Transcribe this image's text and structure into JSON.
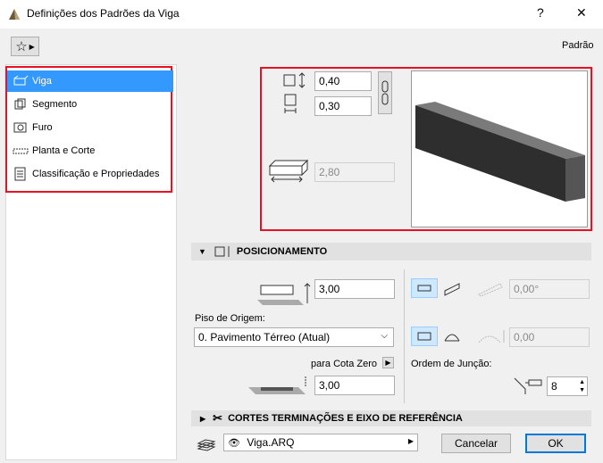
{
  "window": {
    "title": "Definições dos Padrões da Viga",
    "help": "?",
    "close": "✕"
  },
  "header": {
    "favorites_icon": "star-icon",
    "preset_label": "Padrão"
  },
  "sidebar": {
    "items": [
      {
        "label": "Viga",
        "icon": "beam-icon",
        "selected": true
      },
      {
        "label": "Segmento",
        "icon": "segment-icon"
      },
      {
        "label": "Furo",
        "icon": "hole-icon"
      },
      {
        "label": "Planta e Corte",
        "icon": "plan-section-icon"
      },
      {
        "label": "Classificação e Propriedades",
        "icon": "classification-icon"
      }
    ]
  },
  "geometry": {
    "height": "0,40",
    "width": "0,30",
    "length": "2,80"
  },
  "positioning": {
    "section_title": "POSICIONAMENTO",
    "ref_height": "3,00",
    "home_story_label": "Piso de Origem:",
    "home_story_value": "0. Pavimento Térreo (Atual)",
    "to_project_zero_label": "para Cota Zero",
    "project_zero_value": "3,00",
    "slant_angle": "0,00°",
    "curve_value": "0,00",
    "junction_order_label": "Ordem de Junção:",
    "junction_order_value": "8"
  },
  "cuts_section": {
    "title": "CORTES TERMINAÇÕES E EIXO DE REFERÊNCIA"
  },
  "footer": {
    "layer_value": "Viga.ARQ",
    "cancel_label": "Cancelar",
    "ok_label": "OK"
  },
  "colors": {
    "highlight_red": "#e81123",
    "selection_blue": "#3399ff",
    "ok_border": "#0078d7"
  }
}
